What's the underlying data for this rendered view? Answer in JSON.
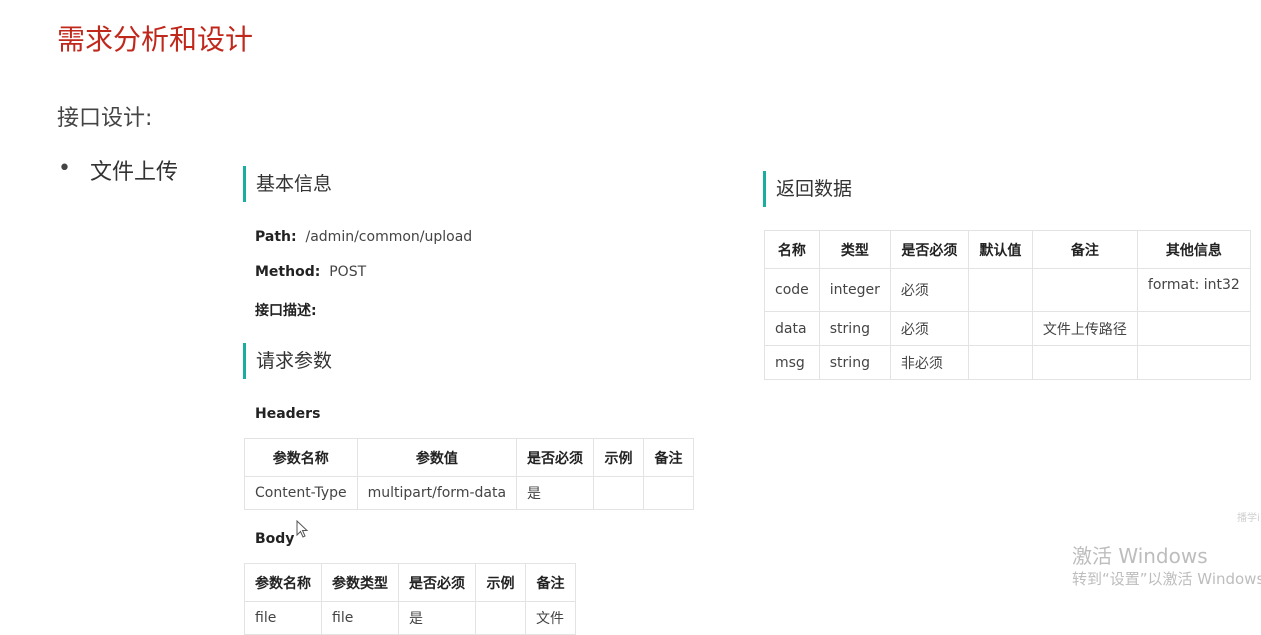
{
  "title": "需求分析和设计",
  "subtitle": "接口设计:",
  "bullet": {
    "dot": "•",
    "text": "文件上传"
  },
  "basic": {
    "heading": "基本信息",
    "path_label": "Path:",
    "path_value": "/admin/common/upload",
    "method_label": "Method:",
    "method_value": "POST",
    "desc_label": "接口描述:"
  },
  "request": {
    "heading": "请求参数",
    "headers_label": "Headers",
    "headers_table": {
      "columns": [
        "参数名称",
        "参数值",
        "是否必须",
        "示例",
        "备注"
      ],
      "rows": [
        [
          "Content-Type",
          "multipart/form-data",
          "是",
          "",
          ""
        ]
      ]
    },
    "body_label": "Body",
    "body_table": {
      "columns": [
        "参数名称",
        "参数类型",
        "是否必须",
        "示例",
        "备注"
      ],
      "rows": [
        [
          "file",
          "file",
          "是",
          "",
          "文件"
        ]
      ]
    }
  },
  "response": {
    "heading": "返回数据",
    "table": {
      "columns": [
        "名称",
        "类型",
        "是否必须",
        "默认值",
        "备注",
        "其他信息"
      ],
      "rows": [
        [
          "code",
          "integer",
          "必须",
          "",
          "",
          "format: int32"
        ],
        [
          "data",
          "string",
          "必须",
          "",
          "文件上传路径",
          ""
        ],
        [
          "msg",
          "string",
          "非必须",
          "",
          "",
          ""
        ]
      ]
    }
  },
  "watermark": {
    "corner": "播学i",
    "line1": "激活 Windows",
    "line2": "转到“设置”以激活 Windows"
  },
  "accent_color": "#1aae9f",
  "title_color": "#c0281c"
}
